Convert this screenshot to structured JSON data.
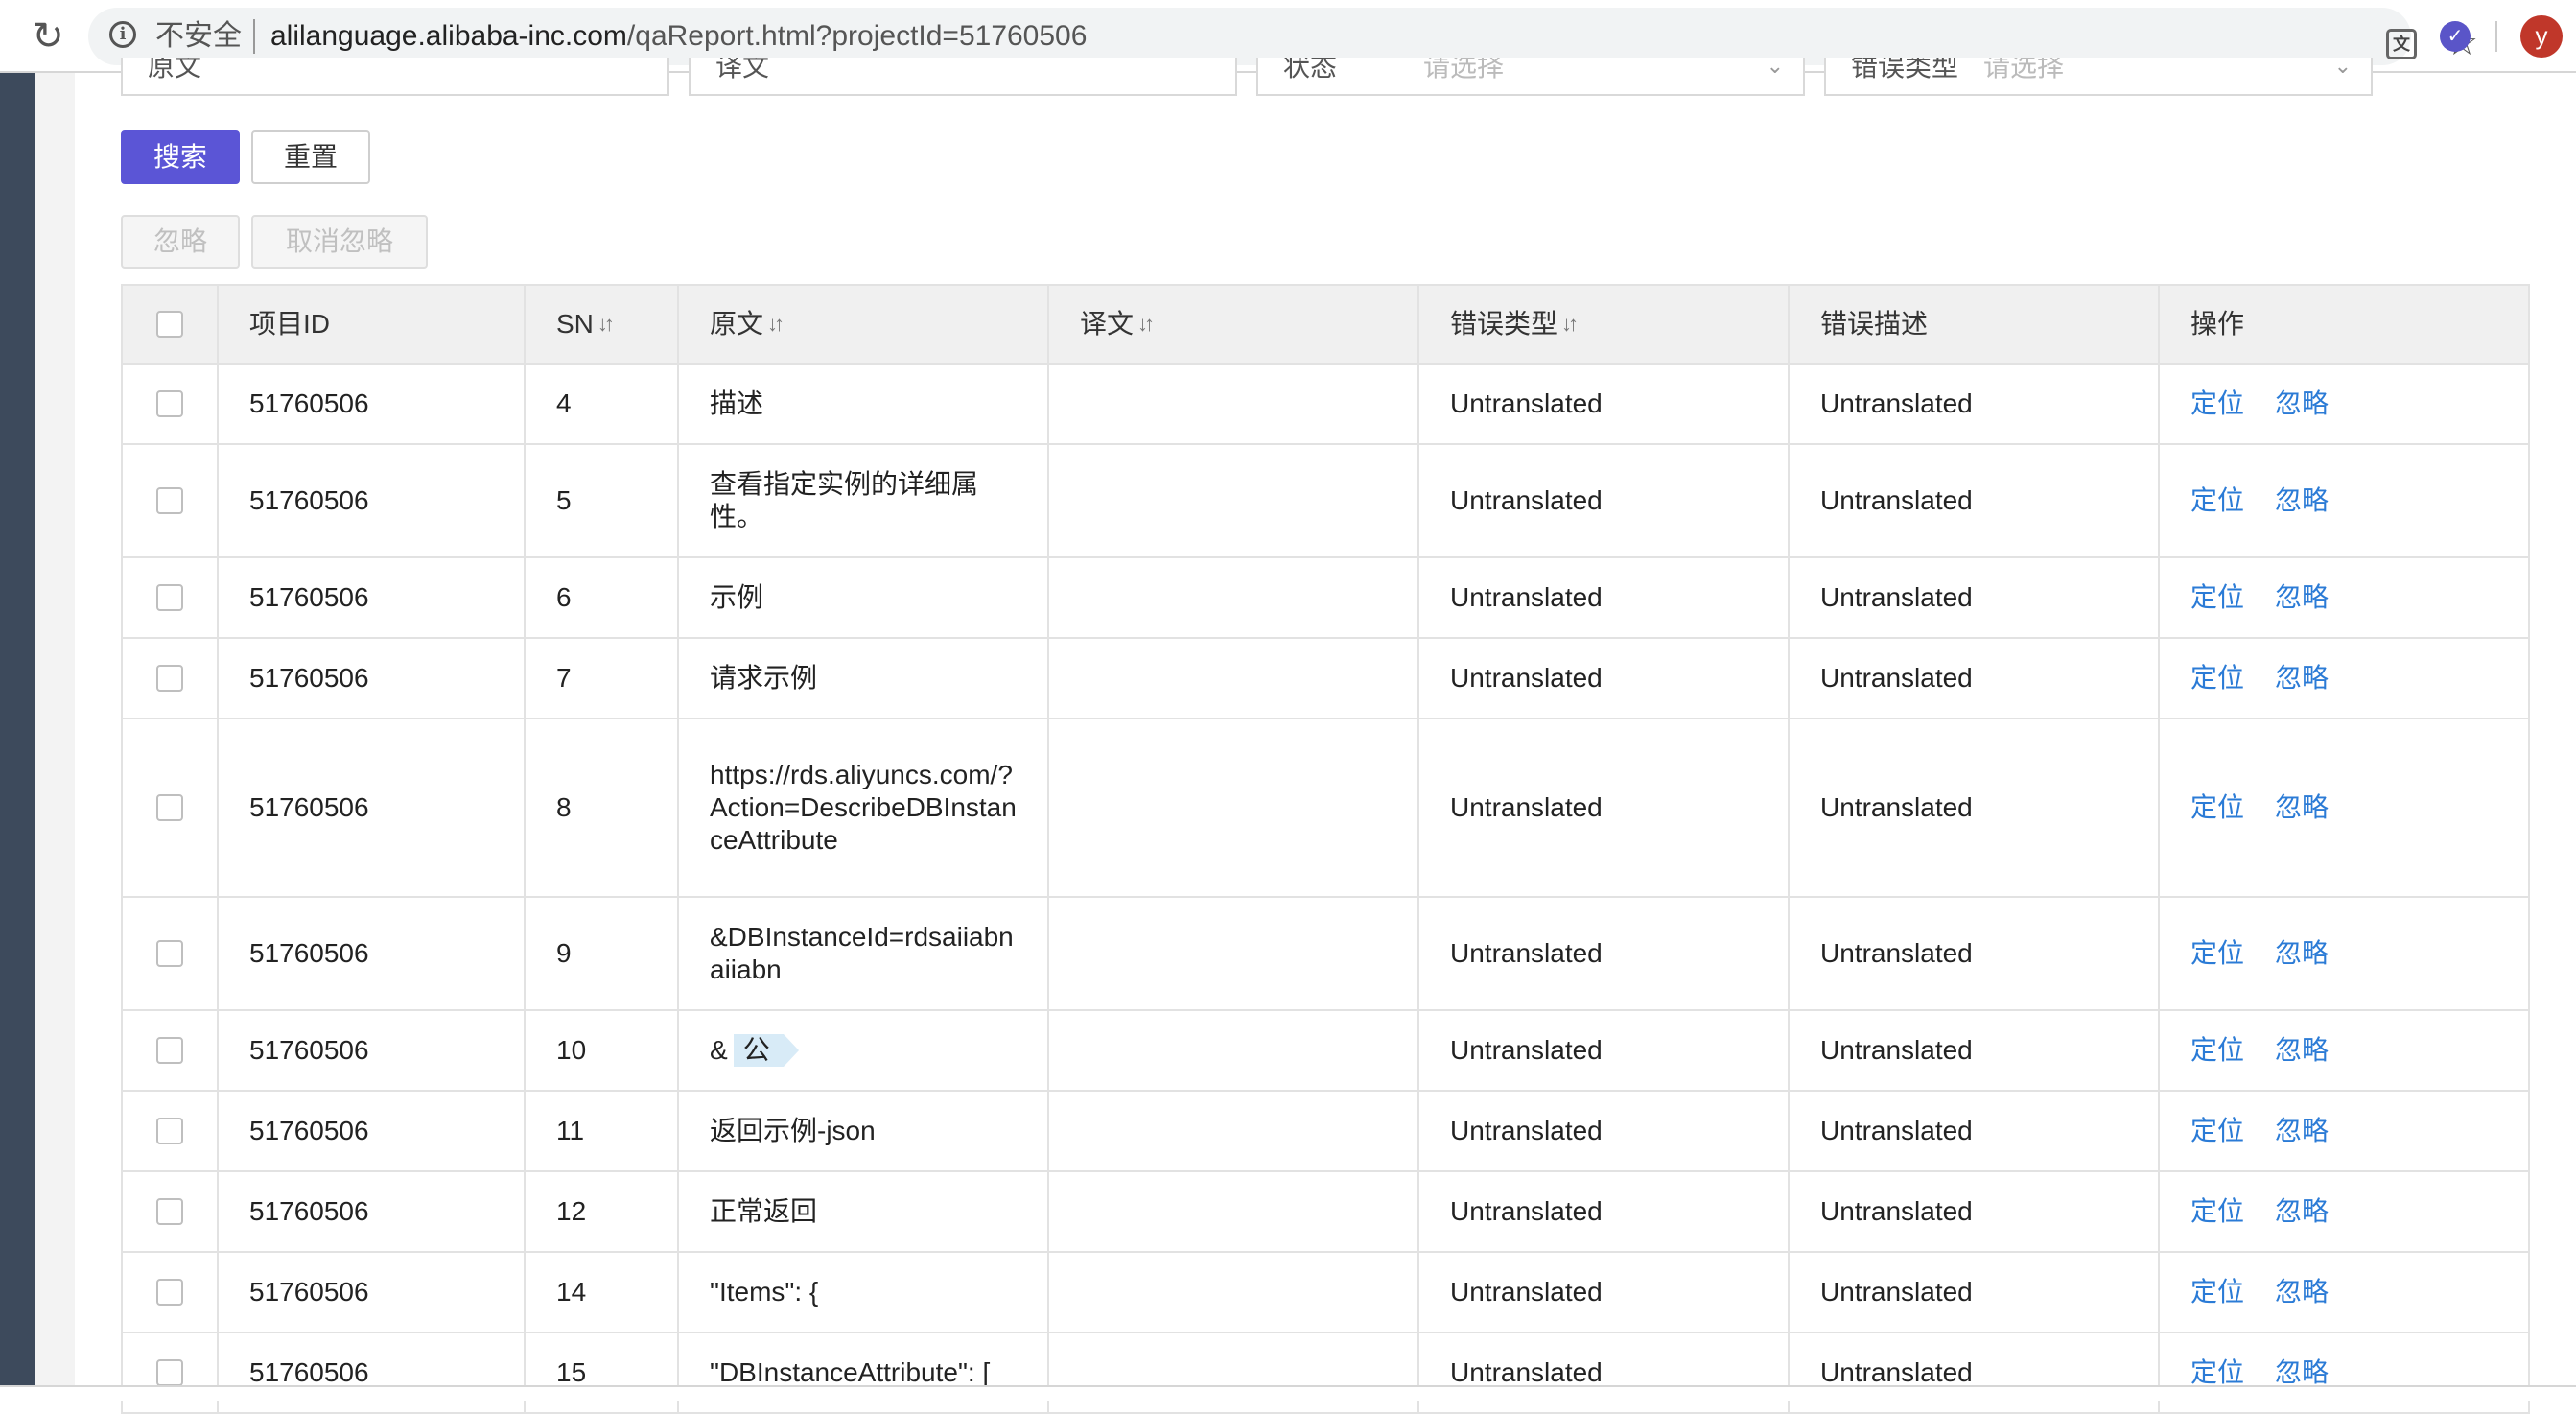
{
  "browser": {
    "security_label": "不安全",
    "url_host": "alilanguage.alibaba-inc.com",
    "url_path": "/qaReport.html?projectId=51760506",
    "avatar_letter": "y"
  },
  "filters": [
    {
      "label": "原文",
      "placeholder": ""
    },
    {
      "label": "译文",
      "placeholder": ""
    },
    {
      "label": "状态",
      "placeholder": "请选择"
    },
    {
      "label": "错误类型",
      "placeholder": "请选择"
    }
  ],
  "actions": {
    "search": "搜索",
    "reset": "重置",
    "ignore": "忽略",
    "unignore": "取消忽略"
  },
  "table": {
    "headers": [
      "项目ID",
      "SN",
      "原文",
      "译文",
      "错误类型",
      "错误描述",
      "操作"
    ],
    "op_locate": "定位",
    "op_ignore": "忽略",
    "rows": [
      {
        "id": "51760506",
        "sn": "4",
        "source": "描述",
        "target": "",
        "type": "Untranslated",
        "desc": "Untranslated"
      },
      {
        "id": "51760506",
        "sn": "5",
        "source": "查看指定实例的详细属性。",
        "target": "",
        "type": "Untranslated",
        "desc": "Untranslated"
      },
      {
        "id": "51760506",
        "sn": "6",
        "source": "示例",
        "target": "",
        "type": "Untranslated",
        "desc": "Untranslated"
      },
      {
        "id": "51760506",
        "sn": "7",
        "source": "请求示例",
        "target": "",
        "type": "Untranslated",
        "desc": "Untranslated"
      },
      {
        "id": "51760506",
        "sn": "8",
        "source": "https://rds.aliyuncs.com/?Action=DescribeDBInstanceAttribute",
        "target": "",
        "type": "Untranslated",
        "desc": "Untranslated"
      },
      {
        "id": "51760506",
        "sn": "9",
        "source": "&DBInstanceId=rdsaiiabnaiiabn",
        "target": "",
        "type": "Untranslated",
        "desc": "Untranslated"
      },
      {
        "id": "51760506",
        "sn": "10",
        "source": "&",
        "source_tag": "公",
        "target": "",
        "type": "Untranslated",
        "desc": "Untranslated"
      },
      {
        "id": "51760506",
        "sn": "11",
        "source": "返回示例-json",
        "target": "",
        "type": "Untranslated",
        "desc": "Untranslated"
      },
      {
        "id": "51760506",
        "sn": "12",
        "source": "正常返回",
        "target": "",
        "type": "Untranslated",
        "desc": "Untranslated"
      },
      {
        "id": "51760506",
        "sn": "14",
        "source": "\"Items\": {",
        "target": "",
        "type": "Untranslated",
        "desc": "Untranslated"
      },
      {
        "id": "51760506",
        "sn": "15",
        "source": "\"DBInstanceAttribute\": [",
        "target": "",
        "type": "Untranslated",
        "desc": "Untranslated"
      }
    ]
  }
}
